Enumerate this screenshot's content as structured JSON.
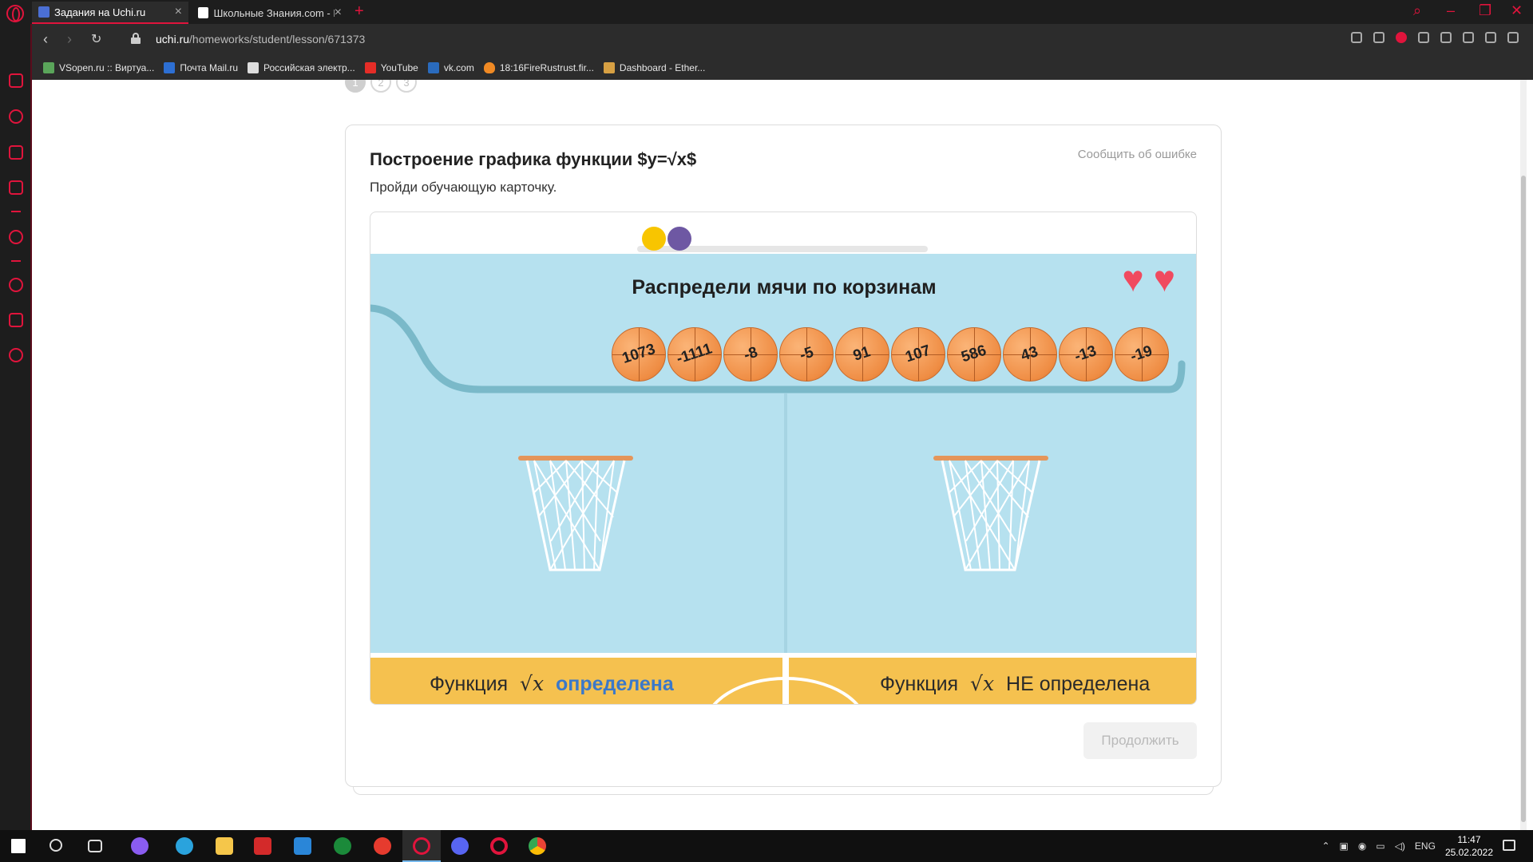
{
  "browser": {
    "tabs": [
      {
        "title": "Задания на Uchi.ru",
        "active": true
      },
      {
        "title": "Школьные Знания.com - Г",
        "active": false
      }
    ],
    "url_host": "uchi.ru",
    "url_path": "/homeworks/student/lesson/671373",
    "bookmarks": [
      "VSopen.ru :: Виртуа...",
      "Почта Mail.ru",
      "Российская электр...",
      "YouTube",
      "vk.com",
      "18:16FireRustrust.fir...",
      "Dashboard - Ether..."
    ]
  },
  "lesson": {
    "steps": [
      "1",
      "2",
      "3"
    ],
    "active_step": 1,
    "title": "Построение графика функции $y=√x$",
    "report_label": "Сообщить об ошибке",
    "subtitle": "Пройди обучающую карточку.",
    "continue_label": "Продолжить"
  },
  "game": {
    "task": "Распредели мячи по корзинам",
    "lives": 2,
    "balls": [
      "1073",
      "-1111",
      "-8",
      "-5",
      "91",
      "107",
      "586",
      "43",
      "-13",
      "-19"
    ],
    "left_label_prefix": "Функция",
    "sqrt_symbol": "√x",
    "left_label_suffix": "определена",
    "right_label_prefix": "Функция",
    "right_label_suffix": "НЕ определена",
    "colors": {
      "court": "#b6e1ef",
      "floor": "#f5c14f",
      "ball": "#ef8d44",
      "accent": "#3b78c9"
    }
  },
  "taskbar": {
    "language": "ENG",
    "time": "11:47",
    "date": "25.02.2022"
  }
}
